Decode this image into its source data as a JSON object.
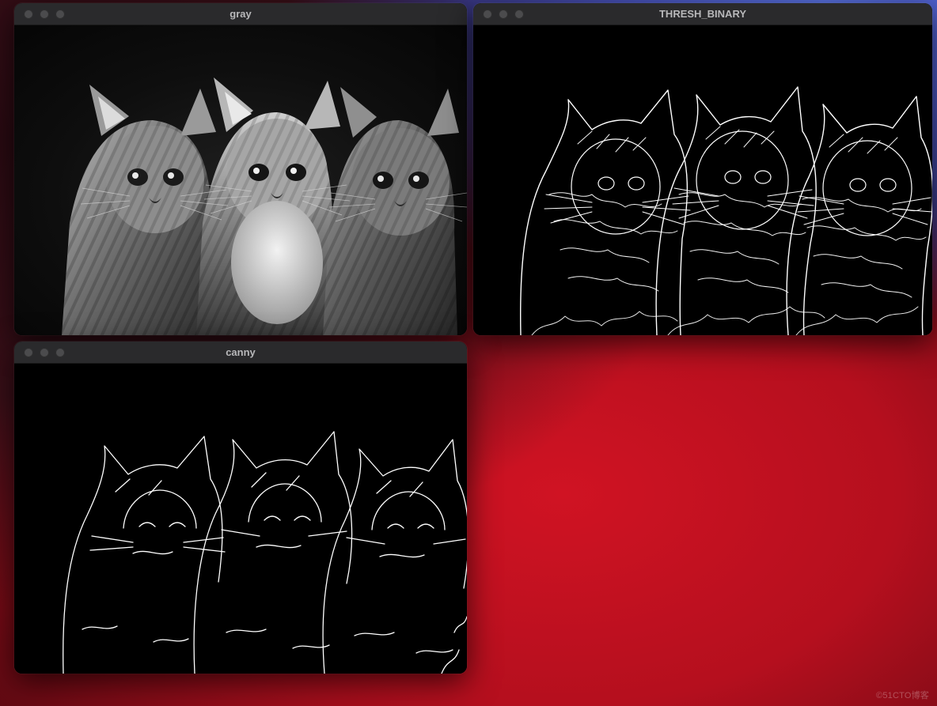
{
  "desktop": {
    "background_name": "macos-big-sur-wave"
  },
  "windows": {
    "gray": {
      "title": "gray",
      "traffic_state": "inactive",
      "content_kind": "grayscale-photo",
      "content_subject": "three kittens"
    },
    "thresh": {
      "title": "THRESH_BINARY",
      "traffic_state": "inactive",
      "content_kind": "binary-edge-map",
      "content_subject": "three kittens edges (dense)"
    },
    "canny": {
      "title": "canny",
      "traffic_state": "inactive",
      "content_kind": "canny-edge-map",
      "content_subject": "three kittens edges (sparse)"
    }
  },
  "watermark": "©51CTO博客"
}
